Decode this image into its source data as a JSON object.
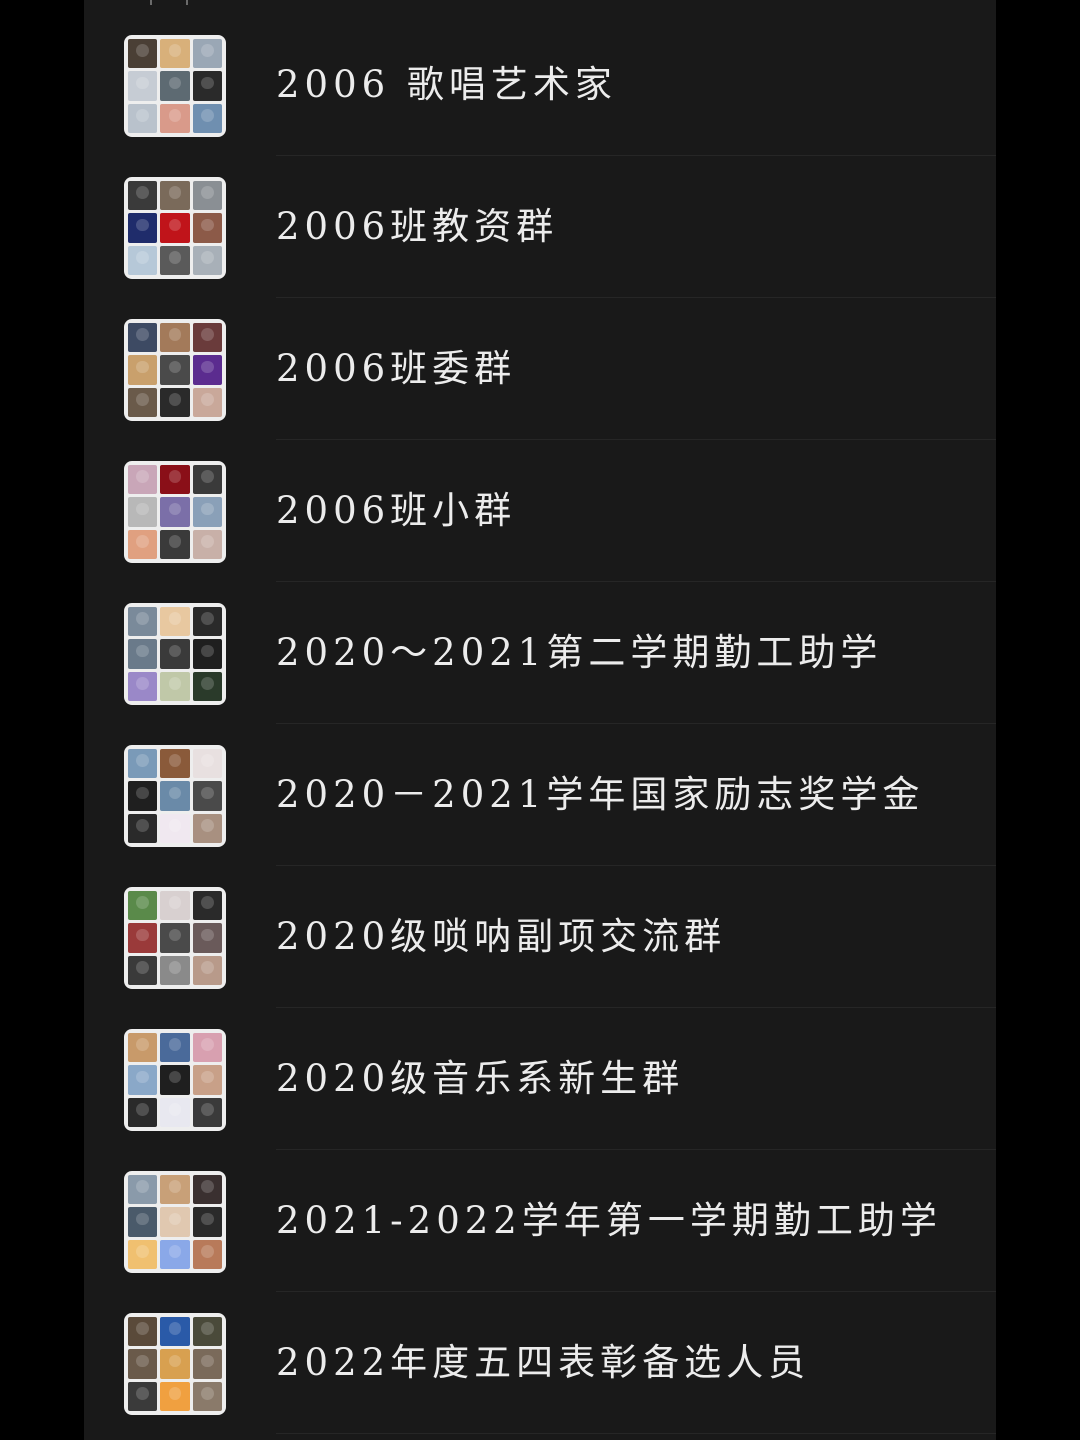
{
  "groups": [
    {
      "name": "2006  歌唱艺术家",
      "avatars": [
        "#4a3f35",
        "#d8b07a",
        "#9aa7b5",
        "#c6ccd4",
        "#5d6a72",
        "#2a2a2a",
        "#b9c2cc",
        "#d99a8a",
        "#6f8fb0"
      ]
    },
    {
      "name": "2006班教资群",
      "avatars": [
        "#3a3a3a",
        "#7a6a5a",
        "#8a8f94",
        "#1f2c6b",
        "#c0141a",
        "#8c5a48",
        "#b6c8d8",
        "#5a5a5a",
        "#a8b0b8"
      ]
    },
    {
      "name": "2006班委群",
      "avatars": [
        "#3d4a63",
        "#a37a5a",
        "#6a3b3b",
        "#c9a06c",
        "#4a4a4a",
        "#5b2c8f",
        "#6a5a4a",
        "#2a2a2a",
        "#c9a89a"
      ]
    },
    {
      "name": "2006班小群",
      "avatars": [
        "#c9a6b8",
        "#8a0f18",
        "#3a3a3a",
        "#b8b8b8",
        "#7b6fa8",
        "#8aa0b8",
        "#e0a080",
        "#3a3a3a",
        "#c8b0a8"
      ]
    },
    {
      "name": "2020～2021第二学期勤工助学",
      "avatars": [
        "#7a8a9a",
        "#e8c8a0",
        "#2a2a2a",
        "#6a7a8a",
        "#3a3a3a",
        "#1f1f1f",
        "#9a88c8",
        "#c0c8a8",
        "#2a3a2a"
      ]
    },
    {
      "name": "2020－2021学年国家励志奖学金",
      "avatars": [
        "#7a9ab8",
        "#8a5a3a",
        "#e8e0e0",
        "#1f1f1f",
        "#6a8aa8",
        "#4a4a4a",
        "#2a2a2a",
        "#f0e8f0",
        "#a89080"
      ]
    },
    {
      "name": "2020级唢呐副项交流群",
      "avatars": [
        "#5a8a4a",
        "#d8d0d0",
        "#2a2a2a",
        "#9a3a3a",
        "#4a4a4a",
        "#6a5a5a",
        "#3a3a3a",
        "#8a8a8a",
        "#b89a8a"
      ]
    },
    {
      "name": "2020级音乐系新生群",
      "avatars": [
        "#c89a6a",
        "#4a6a9a",
        "#d8a0b0",
        "#8aa8c8",
        "#1f1f1f",
        "#c8a088",
        "#2a2a2a",
        "#e8e8f0",
        "#3a3a3a"
      ]
    },
    {
      "name": "2021-2022学年第一学期勤工助学",
      "avatars": [
        "#8a9aaa",
        "#c8a078",
        "#3a3030",
        "#4a5a6a",
        "#e0c8b0",
        "#2a2a2a",
        "#f0c070",
        "#8aa8e8",
        "#b87a5a"
      ]
    },
    {
      "name": "2022年度五四表彰备选人员",
      "avatars": [
        "#5a4a3a",
        "#2a5aa8",
        "#4a4a3a",
        "#6a5a4a",
        "#d8a050",
        "#7a6a5a",
        "#3a3a3a",
        "#f0a040",
        "#8a7a6a"
      ]
    }
  ]
}
